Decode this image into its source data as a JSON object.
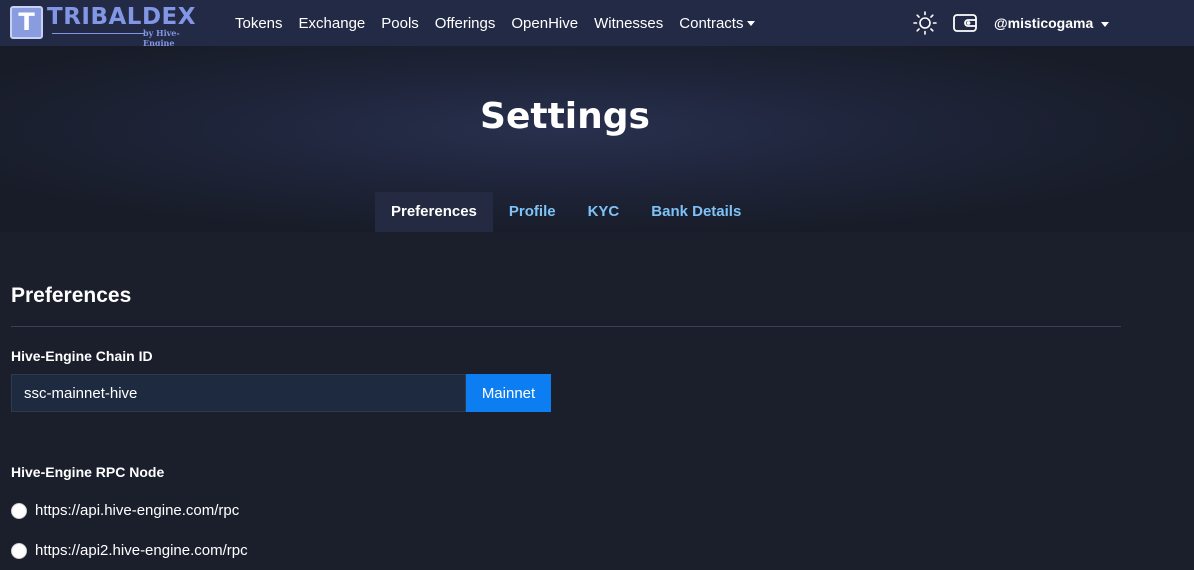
{
  "brand": {
    "logo_letter": "T",
    "name": "TRIBALDEX",
    "tagline": "by Hive-Engine",
    "color": "#8296e6"
  },
  "nav": {
    "links": [
      "Tokens",
      "Exchange",
      "Pools",
      "Offerings",
      "OpenHive",
      "Witnesses",
      "Contracts"
    ],
    "icons": [
      "sun-icon",
      "wallet-icon"
    ],
    "user": "@misticogama"
  },
  "hero": {
    "title": "Settings",
    "tabs": [
      "Preferences",
      "Profile",
      "KYC",
      "Bank Details"
    ],
    "active_tab": "Preferences"
  },
  "preferences": {
    "section_title": "Preferences",
    "chain_id_label": "Hive-Engine Chain ID",
    "chain_id_value": "ssc-mainnet-hive",
    "chain_button": "Mainnet",
    "rpc_label": "Hive-Engine RPC Node",
    "rpc_options": [
      "https://api.hive-engine.com/rpc",
      "https://api2.hive-engine.com/rpc"
    ]
  },
  "colors": {
    "navbar_bg": "#232a45",
    "page_bg": "#1b1f2c",
    "accent": "#0d7ef2",
    "tab_link": "#7ec2f7"
  }
}
